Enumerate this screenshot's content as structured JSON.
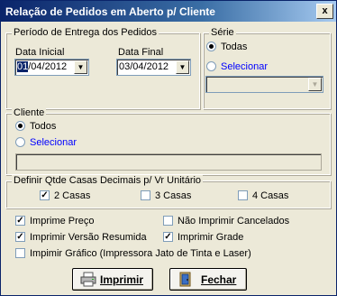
{
  "window": {
    "title": "Relação de Pedidos em Aberto p/ Cliente",
    "close_glyph": "x"
  },
  "periodo": {
    "legend": "Período de Entrega dos Pedidos",
    "data_inicial_label": "Data Inicial",
    "data_inicial_value_sel": "01",
    "data_inicial_value_rest": "/04/2012",
    "data_final_label": "Data Final",
    "data_final_value": "03/04/2012",
    "dropdown_glyph": "▼"
  },
  "serie": {
    "legend": "Série",
    "options": [
      {
        "label": "Todas",
        "selected": true
      },
      {
        "label": "Selecionar",
        "selected": false
      }
    ]
  },
  "cliente": {
    "legend": "Cliente",
    "options": [
      {
        "label": "Todos",
        "selected": true
      },
      {
        "label": "Selecionar",
        "selected": false
      }
    ]
  },
  "casas": {
    "legend": "Definir Qtde Casas Decimais p/  Vr Unitário",
    "options": [
      {
        "label": "2 Casas",
        "checked": true
      },
      {
        "label": "3 Casas",
        "checked": false
      },
      {
        "label": "4 Casas",
        "checked": false
      }
    ]
  },
  "opcoes": {
    "imprime_preco": {
      "label": "Imprime Preço",
      "checked": true
    },
    "nao_imprimir_cancelados": {
      "label": "Não Imprimir Cancelados",
      "checked": false
    },
    "versao_resumida": {
      "label": "Imprimir Versão Resumida",
      "checked": true
    },
    "imprimir_grade": {
      "label": "Imprimir Grade",
      "checked": true
    },
    "imprimir_grafico": {
      "label": "Impimir Gráfico (Impressora Jato de Tinta e Laser)",
      "checked": false
    }
  },
  "buttons": {
    "imprimir": "Imprimir",
    "fechar": "Fechar"
  },
  "colors": {
    "title_start": "#0a246a",
    "face": "#ece9d8",
    "link": "#0000ff"
  }
}
